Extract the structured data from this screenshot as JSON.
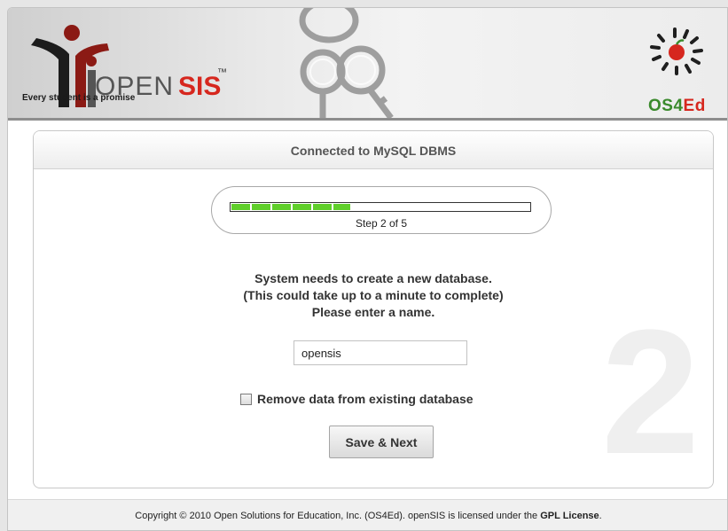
{
  "brand": {
    "name_prefix": "OPEN",
    "name_suffix": "SIS",
    "trademark": "™",
    "tagline": "Every student is a promise",
    "partner_prefix": "OS4",
    "partner_suffix": "Ed"
  },
  "panel": {
    "title": "Connected to MySQL DBMS",
    "step_number": "2",
    "progress": {
      "label": "Step 2 of 5",
      "fraction": 0.4
    },
    "message": {
      "line1": "System needs to create a new database.",
      "line2": "(This could take up to a minute to complete)",
      "line3": "Please enter a name."
    },
    "db_name_value": "opensis",
    "remove_data_label": "Remove data from existing database",
    "remove_data_checked": false,
    "save_button_label": "Save & Next"
  },
  "footer": {
    "text": "Copyright © 2010 Open Solutions for Education, Inc. (OS4Ed). openSIS is licensed under the",
    "license_link": "GPL License",
    "end": "."
  },
  "colors": {
    "progress_green": "#5fcf2a",
    "brand_red": "#d6271e",
    "os4ed_green": "#3a8a2c"
  },
  "icons": [
    "opensis-logo-icon",
    "keys-icon",
    "os4ed-apple-icon"
  ]
}
